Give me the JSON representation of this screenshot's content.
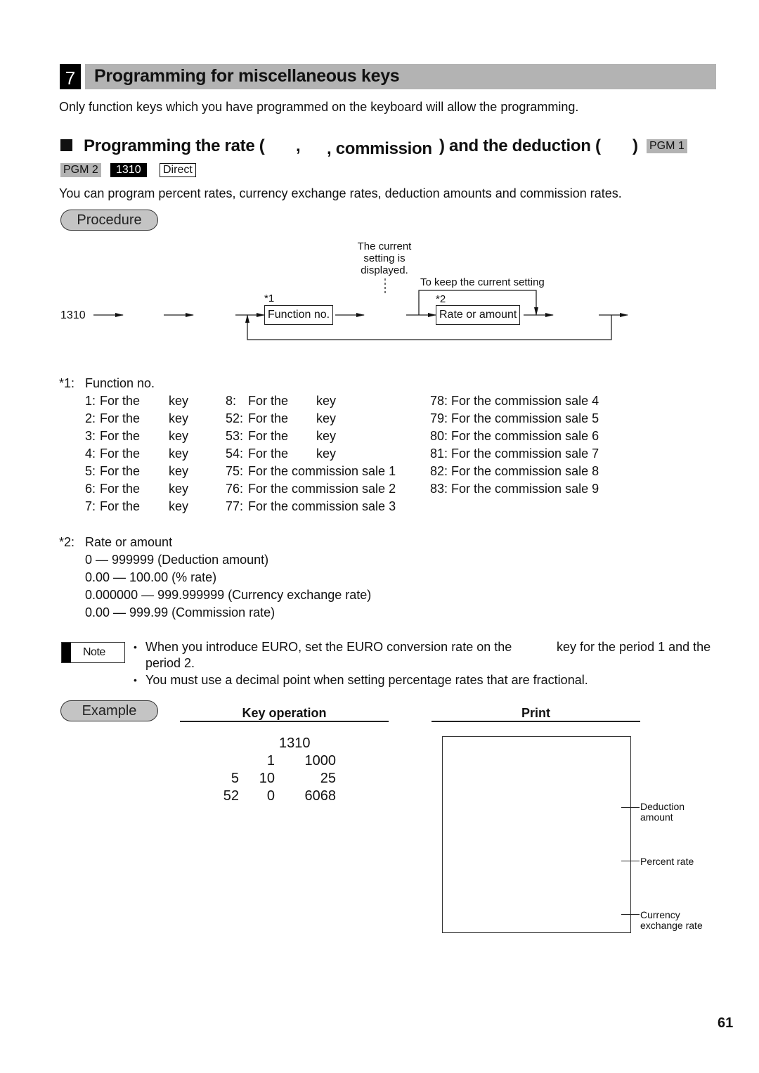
{
  "section": {
    "number": "7",
    "title": "Programming for miscellaneous keys",
    "intro": "Only function keys which you have programmed on the keyboard will allow the programming."
  },
  "subsection": {
    "title_part1": "Programming the rate (",
    "title_sep1": ",",
    "title_part2": ", commission",
    "title_part3": ") and the deduction (",
    "title_close": ")",
    "badges": {
      "pgm1": "PGM 1",
      "pgm2": "PGM 2",
      "code": "1310",
      "direct": "Direct"
    },
    "description": "You can program percent rates, currency exchange rates, deduction amounts and commission rates."
  },
  "procedure": {
    "label": "Procedure",
    "start_code": "1310",
    "annotation_current": [
      "The current",
      "setting is",
      "displayed."
    ],
    "annotation_keep": "To keep the current setting",
    "marker1": "*1",
    "marker2": "*2",
    "box_function": "Function no.",
    "box_rate": "Rate or amount"
  },
  "footnote1": {
    "marker": "*1:",
    "title": "Function no.",
    "col1": [
      {
        "num": "1:",
        "text": "For the",
        "suffix": "key"
      },
      {
        "num": "2:",
        "text": "For the",
        "suffix": "key"
      },
      {
        "num": "3:",
        "text": "For the",
        "suffix": "key"
      },
      {
        "num": "4:",
        "text": "For the",
        "suffix": "key"
      },
      {
        "num": "5:",
        "text": "For the",
        "suffix": "key"
      },
      {
        "num": "6:",
        "text": "For the",
        "suffix": "key"
      },
      {
        "num": "7:",
        "text": "For the",
        "suffix": "key"
      }
    ],
    "col2": [
      {
        "num": "8:",
        "text": "For the",
        "suffix": "key"
      },
      {
        "num": "52:",
        "text": "For the",
        "suffix": "key"
      },
      {
        "num": "53:",
        "text": "For the",
        "suffix": "key"
      },
      {
        "num": "54:",
        "text": "For the",
        "suffix": "key"
      },
      {
        "num": "75:",
        "text": "For the commission sale 1",
        "suffix": ""
      },
      {
        "num": "76:",
        "text": "For the commission sale 2",
        "suffix": ""
      },
      {
        "num": "77:",
        "text": "For the commission sale 3",
        "suffix": ""
      }
    ],
    "col3": [
      "78: For the commission sale 4",
      "79: For the commission sale 5",
      "80: For the commission sale 6",
      "81: For the commission sale 7",
      "82: For the commission sale 8",
      "83: For the commission sale 9"
    ]
  },
  "footnote2": {
    "marker": "*2:",
    "title": "Rate or amount",
    "ranges": [
      "0 — 999999 (Deduction amount)",
      "0.00 — 100.00 (% rate)",
      "0.000000 — 999.999999 (Currency exchange rate)",
      "0.00 — 999.99 (Commission rate)"
    ]
  },
  "note": {
    "label": "Note",
    "bullets": [
      {
        "line1a": "When you introduce EURO, set the EURO conversion rate on the",
        "line1b": "key for the period 1 and the",
        "line2": "period 2."
      },
      {
        "line1a": "You must use a decimal point when setting percentage rates that are fractional."
      }
    ],
    "bullet_char": "•"
  },
  "example": {
    "label": "Example",
    "key_operation_header": "Key operation",
    "print_header": "Print",
    "key_rows": [
      [
        "",
        "",
        "1310"
      ],
      [
        "",
        "1",
        "1000"
      ],
      [
        "5",
        "10",
        "25"
      ],
      [
        "52",
        "0",
        "6068"
      ]
    ],
    "print_callouts": [
      [
        "Deduction",
        "amount"
      ],
      [
        "Percent rate"
      ],
      [
        "Currency",
        "exchange rate"
      ]
    ]
  },
  "page_number": "61"
}
